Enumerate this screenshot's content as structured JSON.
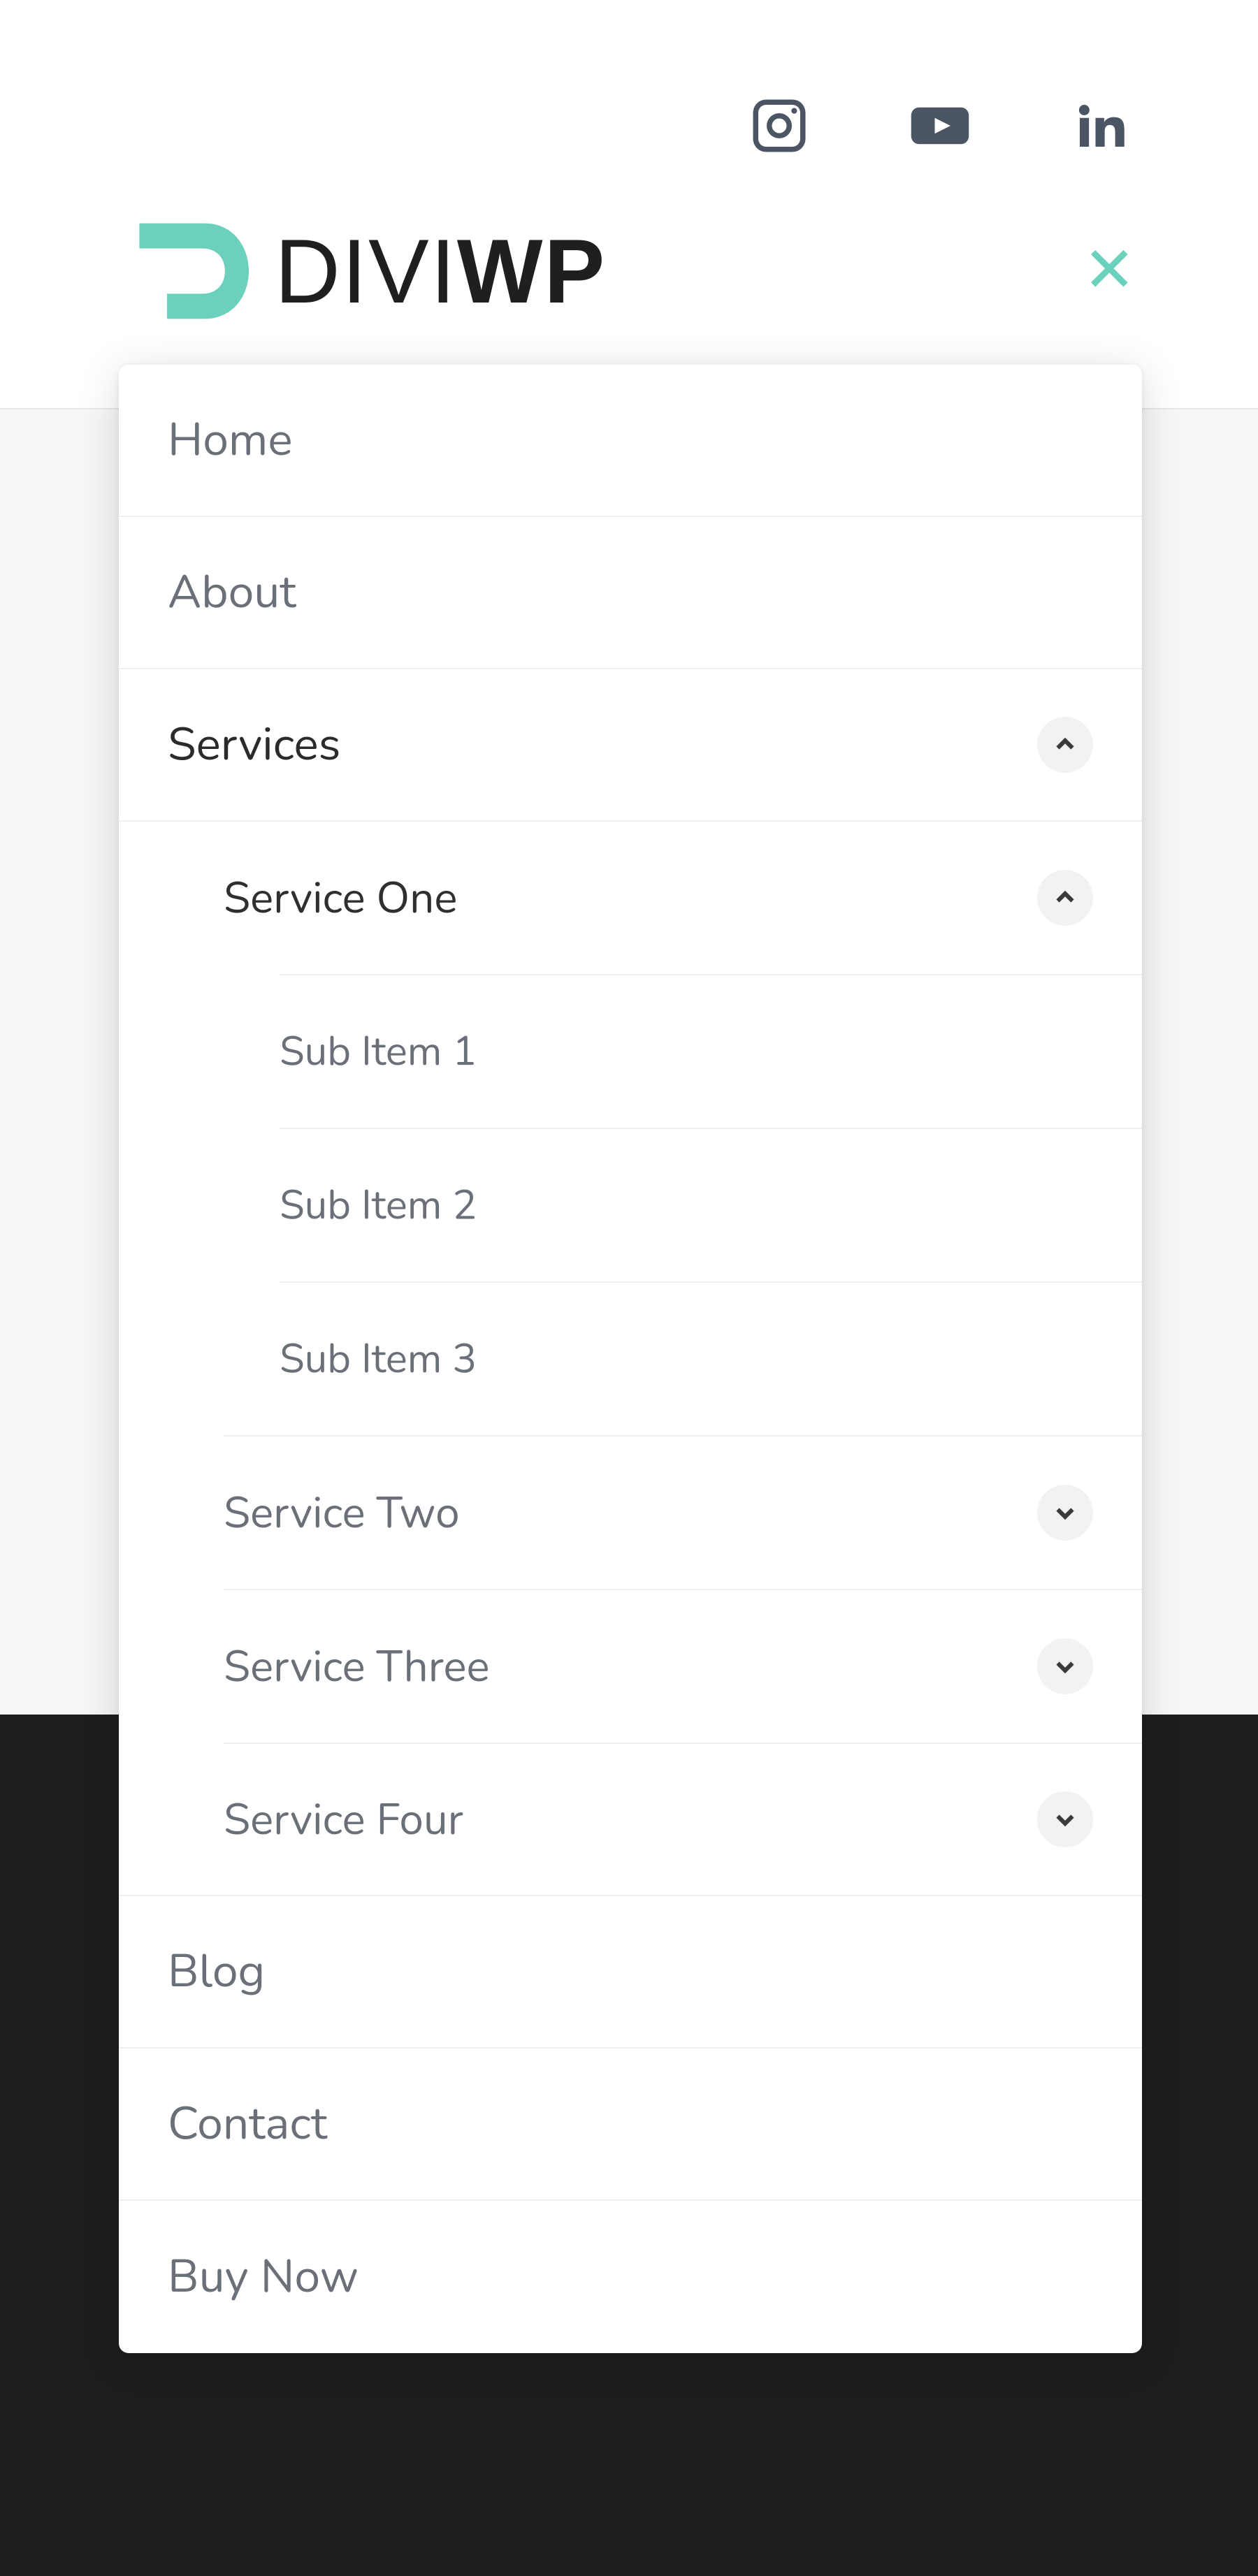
{
  "brand": {
    "name_light": "DIVI",
    "name_bold": "WP",
    "accent": "#6bd1bd"
  },
  "social": {
    "instagram": "instagram",
    "youtube": "youtube",
    "linkedin": "linkedin"
  },
  "menu": {
    "home": "Home",
    "about": "About",
    "services": "Services",
    "service_one": "Service One",
    "sub1": "Sub Item 1",
    "sub2": "Sub Item 2",
    "sub3": "Sub Item 3",
    "service_two": "Service Two",
    "service_three": "Service Three",
    "service_four": "Service Four",
    "blog": "Blog",
    "contact": "Contact",
    "buy_now": "Buy Now"
  }
}
